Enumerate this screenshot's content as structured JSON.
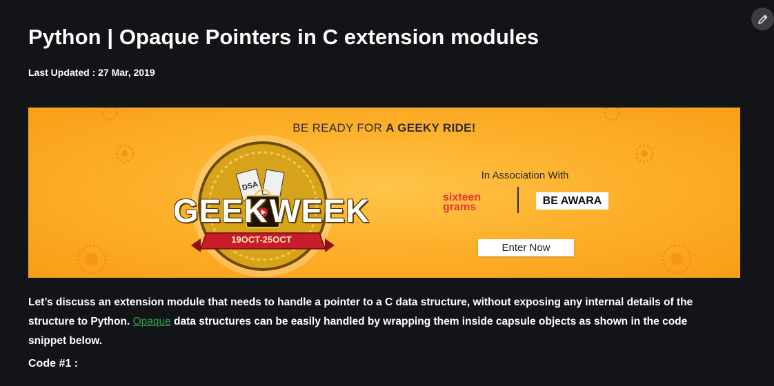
{
  "article": {
    "title": "Python | Opaque Pointers in C extension modules",
    "last_updated": "Last Updated : 27 Mar, 2019",
    "edit_icon": "pencil-icon"
  },
  "banner": {
    "headline_prefix": "BE READY FOR ",
    "headline_bold": "A GEEKY RIDE!",
    "logo_word_1": "GEEK",
    "logo_word_2": "WEEK",
    "dates": "19OCT-25OCT",
    "association": "In Association With",
    "sponsor_1_line1": "sixteen",
    "sponsor_1_line2": "grams",
    "sponsor_2": "BE AWARA",
    "cta": "Enter Now",
    "colors": {
      "background": "#fdb12c",
      "sixteen_grams": "#e8343a",
      "ribbon": "#c91c2a"
    }
  },
  "content": {
    "para_before_link": "Let’s discuss an extension module that needs to handle a pointer to a C data structure, without exposing any internal details of the structure to Python. ",
    "link_text": "Opaque",
    "para_after_link": " data structures can be easily handled by wrapping them inside capsule objects as shown in the code snippet below.",
    "code_label": "Code #1 :",
    "link_color": "#2f9e48"
  }
}
